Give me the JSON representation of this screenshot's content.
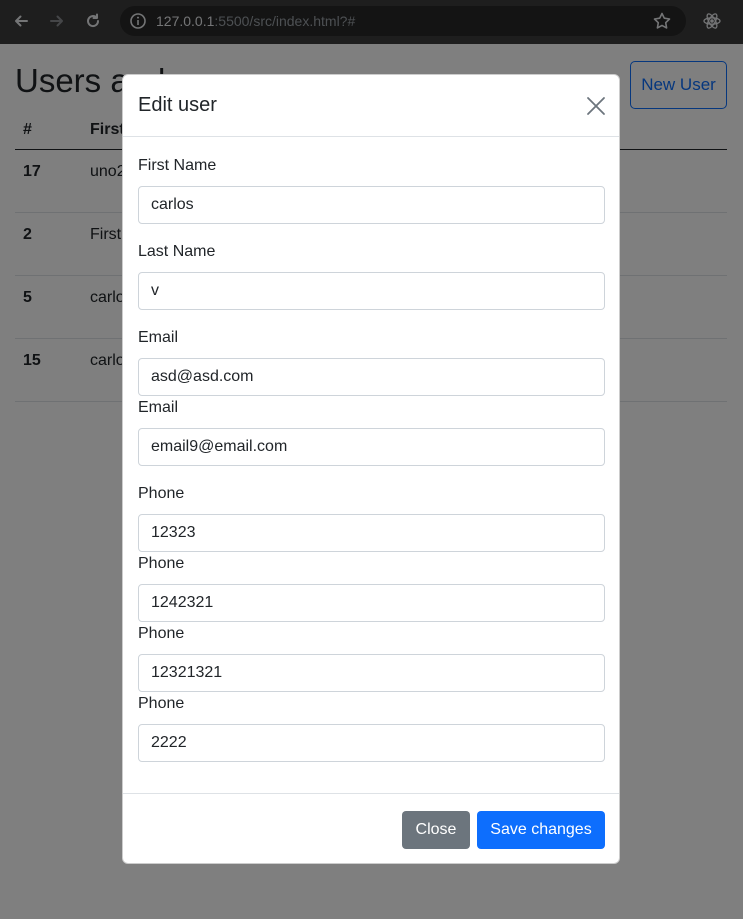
{
  "browser": {
    "url_host": "127.0.0.1",
    "url_rest": ":5500/src/index.html?#"
  },
  "page": {
    "title": "Users and",
    "new_user_label": "New User",
    "table": {
      "headers": [
        "#",
        "First"
      ],
      "rows": [
        {
          "id": "17",
          "first": "uno2"
        },
        {
          "id": "2",
          "first": "First"
        },
        {
          "id": "5",
          "first": "carlo"
        },
        {
          "id": "15",
          "first": "carlo"
        }
      ]
    }
  },
  "modal": {
    "title": "Edit user",
    "fields": [
      {
        "label": "First Name",
        "value": "carlos"
      },
      {
        "label": "Last Name",
        "value": "v"
      },
      {
        "label": "Email",
        "value": "asd@asd.com"
      },
      {
        "label": "Email",
        "value": "email9@email.com"
      },
      {
        "label": "Phone",
        "value": "12323"
      },
      {
        "label": "Phone",
        "value": "1242321"
      },
      {
        "label": "Phone",
        "value": "12321321"
      },
      {
        "label": "Phone",
        "value": "2222"
      }
    ],
    "close_label": "Close",
    "save_label": "Save changes"
  },
  "icons": {
    "back": "back-arrow-icon",
    "forward": "forward-arrow-icon",
    "reload": "reload-icon",
    "info": "info-icon",
    "star": "star-icon",
    "extension": "react-devtools-icon",
    "close": "close-icon"
  },
  "colors": {
    "primary": "#0d6efd",
    "secondary": "#6c757d"
  }
}
